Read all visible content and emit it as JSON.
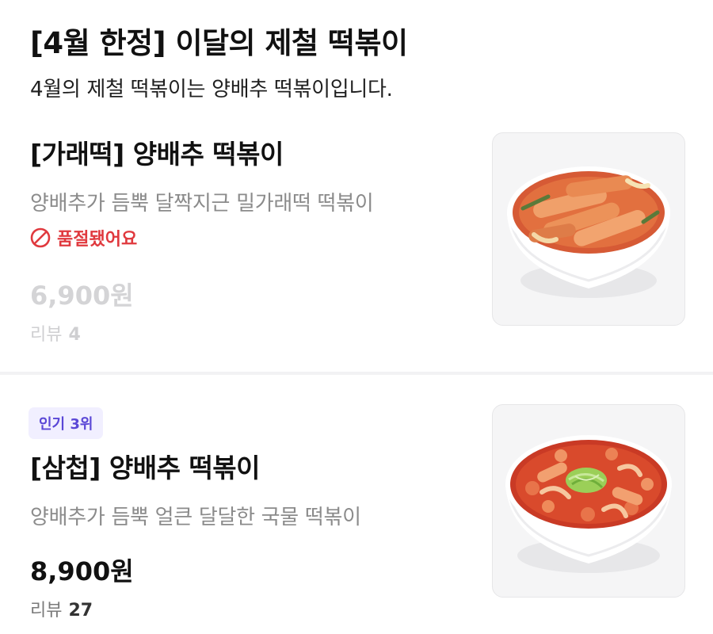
{
  "section": {
    "title": "[4월 한정] 이달의 제철 떡볶이",
    "description": "4월의 제철 떡볶이는 양배추 떡볶이입니다."
  },
  "items": [
    {
      "name": "[가래떡] 양배추 떡볶이",
      "description": "양배추가 듬뿍 달짝지근 밀가래떡 떡볶이",
      "status": "품절됐어요",
      "status_icon": "prohibited-icon",
      "price": "6,900원",
      "review_label": "리뷰",
      "review_count": "4",
      "image_icon": "tteokbokki-bowl-image"
    },
    {
      "badge": "인기 3위",
      "name": "[삼첩] 양배추 떡볶이",
      "description": "양배추가 듬뿍 얼큰 달달한 국물 떡볶이",
      "price": "8,900원",
      "review_label": "리뷰",
      "review_count": "27",
      "image_icon": "tteokbokki-bowl-image"
    }
  ],
  "colors": {
    "soldout": "#e0393e",
    "badge_text": "#5a47d6",
    "badge_bg": "#f1efff",
    "dim_text": "#d4d4d6"
  }
}
